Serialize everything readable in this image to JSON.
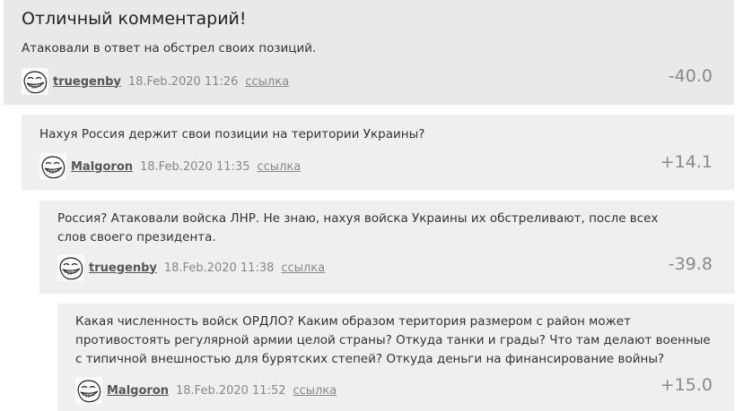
{
  "comments": [
    {
      "title": "Отличный комментарий!",
      "text": "Атаковали в ответ на обстрел своих позиций.",
      "author": "truegenby",
      "date": "18.Feb.2020 11:26",
      "link": "ссылка",
      "score": "-40.0",
      "avatar_icon": "trollface-avatar-icon"
    },
    {
      "text": "Нахуя Россия держит свои позиции на територии Украины?",
      "author": "Malgoron",
      "date": "18.Feb.2020 11:35",
      "link": "ссылка",
      "score": "+14.1",
      "avatar_icon": "trollface-avatar-icon"
    },
    {
      "text": "Россия? Атаковали войска ЛНР. Не знаю, нахуя войска Украины их обстреливают, после всех слов своего президента.",
      "author": "truegenby",
      "date": "18.Feb.2020 11:38",
      "link": "ссылка",
      "score": "-39.8",
      "avatar_icon": "trollface-avatar-icon"
    },
    {
      "text": "Какая численность войск ОРДЛО? Каким образом територия размером с район может противостоять регулярной армии целой страны? Откуда танки и грады? Что там делают военные с типичной внешностью для бурятских степей? Откуда деньги на финансирование войны?",
      "author": "Malgoron",
      "date": "18.Feb.2020 11:52",
      "link": "ссылка",
      "score": "+15.0",
      "avatar_icon": "trollface-avatar-icon"
    }
  ]
}
